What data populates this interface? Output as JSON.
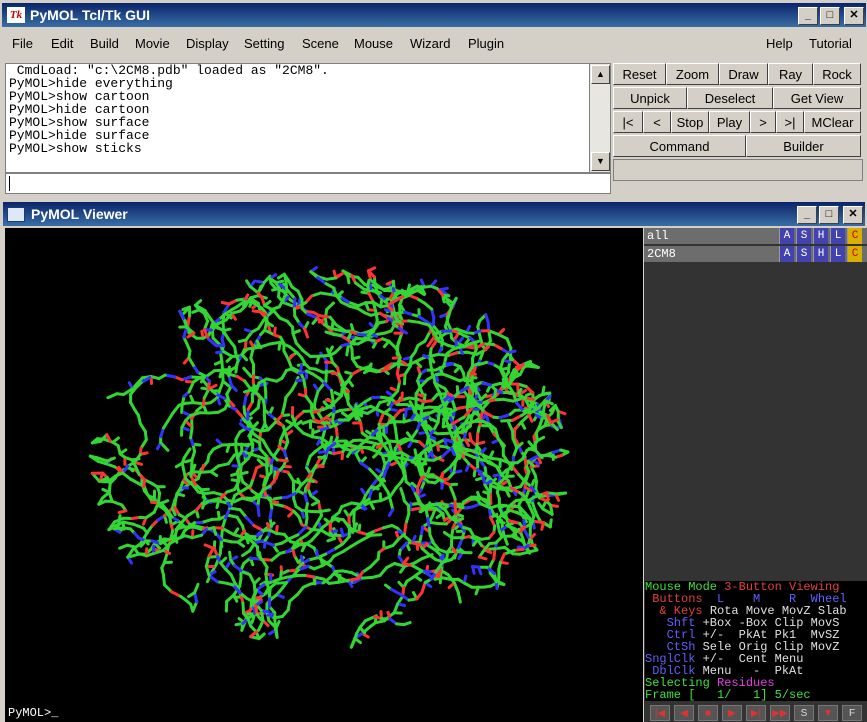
{
  "gui": {
    "title": "PyMOL Tcl/Tk GUI",
    "icon_text": "Tk",
    "menus": [
      "File",
      "Edit",
      "Build",
      "Movie",
      "Display",
      "Setting",
      "Scene",
      "Mouse",
      "Wizard",
      "Plugin"
    ],
    "menus_right": [
      "Help",
      "Tutorial"
    ],
    "console_lines": [
      " CmdLoad: \"c:\\2CM8.pdb\" loaded as \"2CM8\".",
      "PyMOL>hide everything",
      "PyMOL>show cartoon",
      "PyMOL>hide cartoon",
      "PyMOL>show surface",
      "PyMOL>hide surface",
      "PyMOL>show sticks"
    ],
    "command_value": "",
    "buttons": {
      "reset": "Reset",
      "zoom": "Zoom",
      "draw": "Draw",
      "ray": "Ray",
      "rock": "Rock",
      "unpick": "Unpick",
      "deselect": "Deselect",
      "get_view": "Get View",
      "first": "|<",
      "prev": "<",
      "stop": "Stop",
      "play": "Play",
      "next": ">",
      "last": ">|",
      "mclear": "MClear",
      "command": "Command",
      "builder": "Builder"
    }
  },
  "viewer": {
    "title": "PyMOL Viewer",
    "prompt": "PyMOL>_",
    "objects": [
      {
        "name": "all",
        "buttons": [
          "A",
          "S",
          "H",
          "L",
          "C"
        ]
      },
      {
        "name": "2CM8",
        "buttons": [
          "A",
          "S",
          "H",
          "L",
          "C"
        ]
      }
    ],
    "mouse_info": {
      "line1a": "Mouse Mode ",
      "line1b": "3-Button Viewing",
      "line2a": " Buttons ",
      "line2b": " L    M    R  Wheel",
      "line3a": "  & Keys ",
      "line3b": "Rota Move MovZ Slab",
      "line4a": "   Shft ",
      "line4b": "+Box -Box Clip MovS",
      "line5a": "   Ctrl ",
      "line5b": "+/-  PkAt Pk1  MvSZ",
      "line6a": "   CtSh ",
      "line6b": "Sele Orig Clip MovZ",
      "line7a": "SnglClk ",
      "line7b": "+/-  Cent Menu",
      "line8a": " DblClk ",
      "line8b": "Menu   -  PkAt",
      "line9a": "Selecting ",
      "line9b": "Residues",
      "line10": "Frame [   1/   1] 5/sec"
    },
    "playbar": [
      "|◀",
      "◀",
      "■",
      "▶",
      "▶|",
      "▶▶",
      "S",
      "▼",
      "F"
    ],
    "stick_colors": {
      "carbon": "#33d633",
      "nitrogen": "#3333ff",
      "oxygen": "#ff3333"
    }
  }
}
